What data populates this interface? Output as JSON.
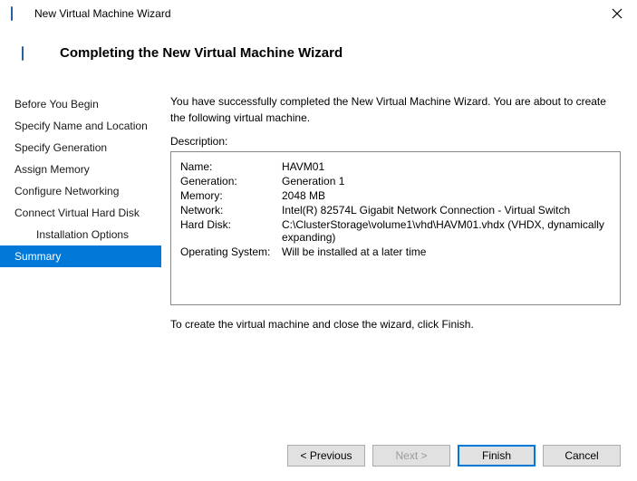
{
  "window": {
    "title": "New Virtual Machine Wizard"
  },
  "header": {
    "title": "Completing the New Virtual Machine Wizard"
  },
  "sidebar": {
    "items": [
      {
        "label": "Before You Begin",
        "sub": false
      },
      {
        "label": "Specify Name and Location",
        "sub": false
      },
      {
        "label": "Specify Generation",
        "sub": false
      },
      {
        "label": "Assign Memory",
        "sub": false
      },
      {
        "label": "Configure Networking",
        "sub": false
      },
      {
        "label": "Connect Virtual Hard Disk",
        "sub": false
      },
      {
        "label": "Installation Options",
        "sub": true
      },
      {
        "label": "Summary",
        "sub": false,
        "selected": true
      }
    ]
  },
  "main": {
    "intro": "You have successfully completed the New Virtual Machine Wizard. You are about to create the following virtual machine.",
    "desc_label": "Description:",
    "rows": [
      {
        "k": "Name:",
        "v": "HAVM01"
      },
      {
        "k": "Generation:",
        "v": "Generation 1"
      },
      {
        "k": "Memory:",
        "v": "2048 MB"
      },
      {
        "k": "Network:",
        "v": "Intel(R) 82574L Gigabit Network Connection - Virtual Switch"
      },
      {
        "k": "Hard Disk:",
        "v": "C:\\ClusterStorage\\volume1\\vhd\\HAVM01.vhdx (VHDX, dynamically expanding)"
      },
      {
        "k": "Operating System:",
        "v": "Will be installed at a later time"
      }
    ],
    "outro": "To create the virtual machine and close the wizard, click Finish."
  },
  "buttons": {
    "previous": "< Previous",
    "next": "Next >",
    "finish": "Finish",
    "cancel": "Cancel"
  }
}
